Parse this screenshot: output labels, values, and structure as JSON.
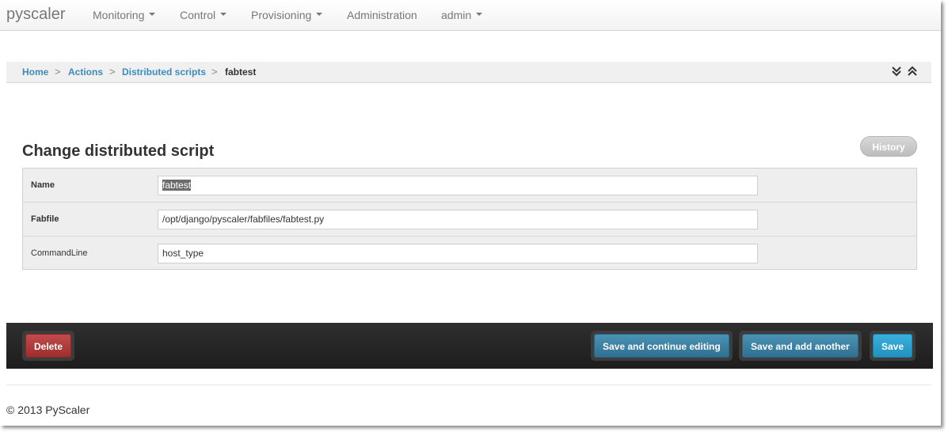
{
  "navbar": {
    "brand": "pyscaler",
    "items": [
      {
        "label": "Monitoring",
        "dropdown": true
      },
      {
        "label": "Control",
        "dropdown": true
      },
      {
        "label": "Provisioning",
        "dropdown": true
      },
      {
        "label": "Administration",
        "dropdown": false
      },
      {
        "label": "admin",
        "dropdown": true
      }
    ]
  },
  "breadcrumb": {
    "items": [
      "Home",
      "Actions",
      "Distributed scripts",
      "fabtest"
    ],
    "separator": ">"
  },
  "page": {
    "title": "Change distributed script",
    "history_label": "History"
  },
  "form": {
    "fields": [
      {
        "label": "Name",
        "value": "fabtest"
      },
      {
        "label": "Fabfile",
        "value": "/opt/django/pyscaler/fabfiles/fabtest.py"
      },
      {
        "label": "CommandLine",
        "value": "host_type"
      }
    ]
  },
  "actions": {
    "delete_label": "Delete",
    "save_continue_label": "Save and continue editing",
    "save_add_label": "Save and add another",
    "save_label": "Save"
  },
  "footer": {
    "text": "© 2013 PyScaler"
  },
  "colors": {
    "link": "#3a8cbf",
    "danger": "#b03c3c",
    "primary": "#2a9fcf",
    "secondary": "#3b83a6"
  }
}
